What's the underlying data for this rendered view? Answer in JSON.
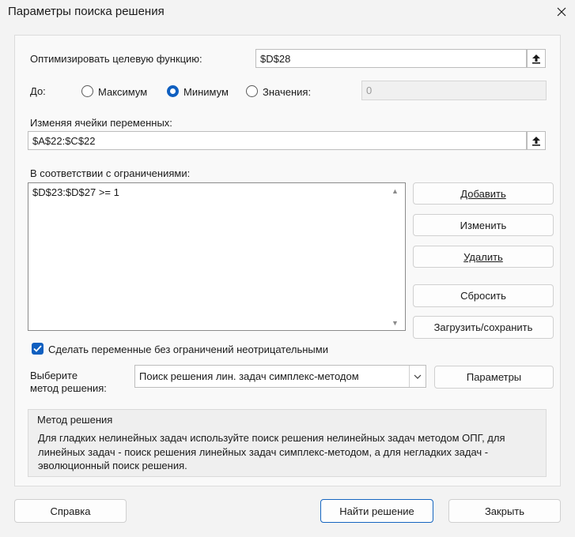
{
  "window": {
    "title": "Параметры поиска решения",
    "close_icon": "close-icon"
  },
  "objective": {
    "label": "Оптимизировать целевую функцию:",
    "value": "$D$28"
  },
  "to": {
    "label": "До:",
    "options": [
      {
        "label": "Максимум",
        "selected": false
      },
      {
        "label": "Минимум",
        "selected": true
      },
      {
        "label": "Значения:",
        "selected": false
      }
    ],
    "value_field": "0"
  },
  "variables": {
    "label": "Изменяя ячейки переменных:",
    "value": "$A$22:$C$22"
  },
  "constraints": {
    "label": "В соответствии с ограничениями:",
    "items": [
      "$D$23:$D$27 >= 1"
    ]
  },
  "buttons": {
    "add": "Добавить",
    "change": "Изменить",
    "delete": "Удалить",
    "reset": "Сбросить",
    "load_save": "Загрузить/сохранить",
    "options": "Параметры",
    "help": "Справка",
    "solve": "Найти решение",
    "close": "Закрыть"
  },
  "nonnegative": {
    "label": "Сделать переменные без ограничений неотрицательными",
    "checked": true
  },
  "method": {
    "label_line1": "Выберите",
    "label_line2": "метод решения:",
    "selected": "Поиск решения лин. задач симплекс-методом"
  },
  "method_info": {
    "heading": "Метод решения",
    "line1": "Для гладких нелинейных задач используйте поиск решения нелинейных задач методом ОПГ, для",
    "line2": "линейных задач - поиск решения линейных задач симплекс-методом, а для негладких задач -",
    "line3": "эволюционный поиск решения."
  },
  "colors": {
    "accent": "#0f5fc0",
    "window_bg": "#f3f3f3",
    "panel_bg": "#f9f9f9"
  }
}
